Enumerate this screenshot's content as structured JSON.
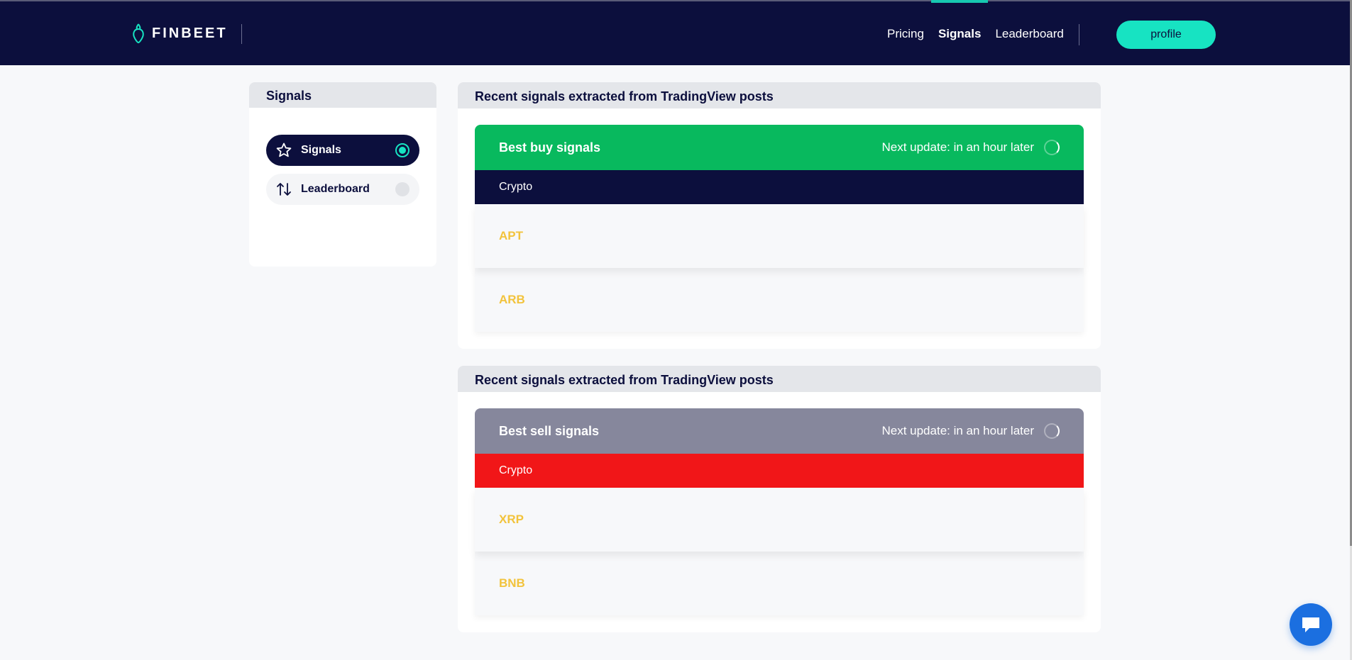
{
  "header": {
    "logo_text": "FINBEET",
    "nav": [
      {
        "label": "Pricing",
        "active": false
      },
      {
        "label": "Signals",
        "active": true
      },
      {
        "label": "Leaderboard",
        "active": false
      }
    ],
    "profile_label": "profile"
  },
  "sidebar": {
    "title": "Signals",
    "items": [
      {
        "label": "Signals",
        "icon": "star-icon",
        "active": true
      },
      {
        "label": "Leaderboard",
        "icon": "sort-arrows-icon",
        "active": false
      }
    ]
  },
  "panels": [
    {
      "title": "Recent signals extracted from TradingView posts",
      "card_title": "Best buy signals",
      "update_text": "Next update: in an hour later",
      "category": "Crypto",
      "symbols": [
        "APT",
        "ARB"
      ]
    },
    {
      "title": "Recent signals extracted from TradingView posts",
      "card_title": "Best sell signals",
      "update_text": "Next update: in an hour later",
      "category": "Crypto",
      "symbols": [
        "XRP",
        "BNB"
      ]
    }
  ],
  "colors": {
    "navy": "#0c0f3d",
    "teal": "#17e3c2",
    "buy_green": "#08b95e",
    "sell_gray": "#86879c",
    "sell_red": "#f11618",
    "symbol_gold": "#f2c33c",
    "chat_blue": "#1b6fe0"
  },
  "chat": {
    "icon": "chat-bubble-icon"
  }
}
